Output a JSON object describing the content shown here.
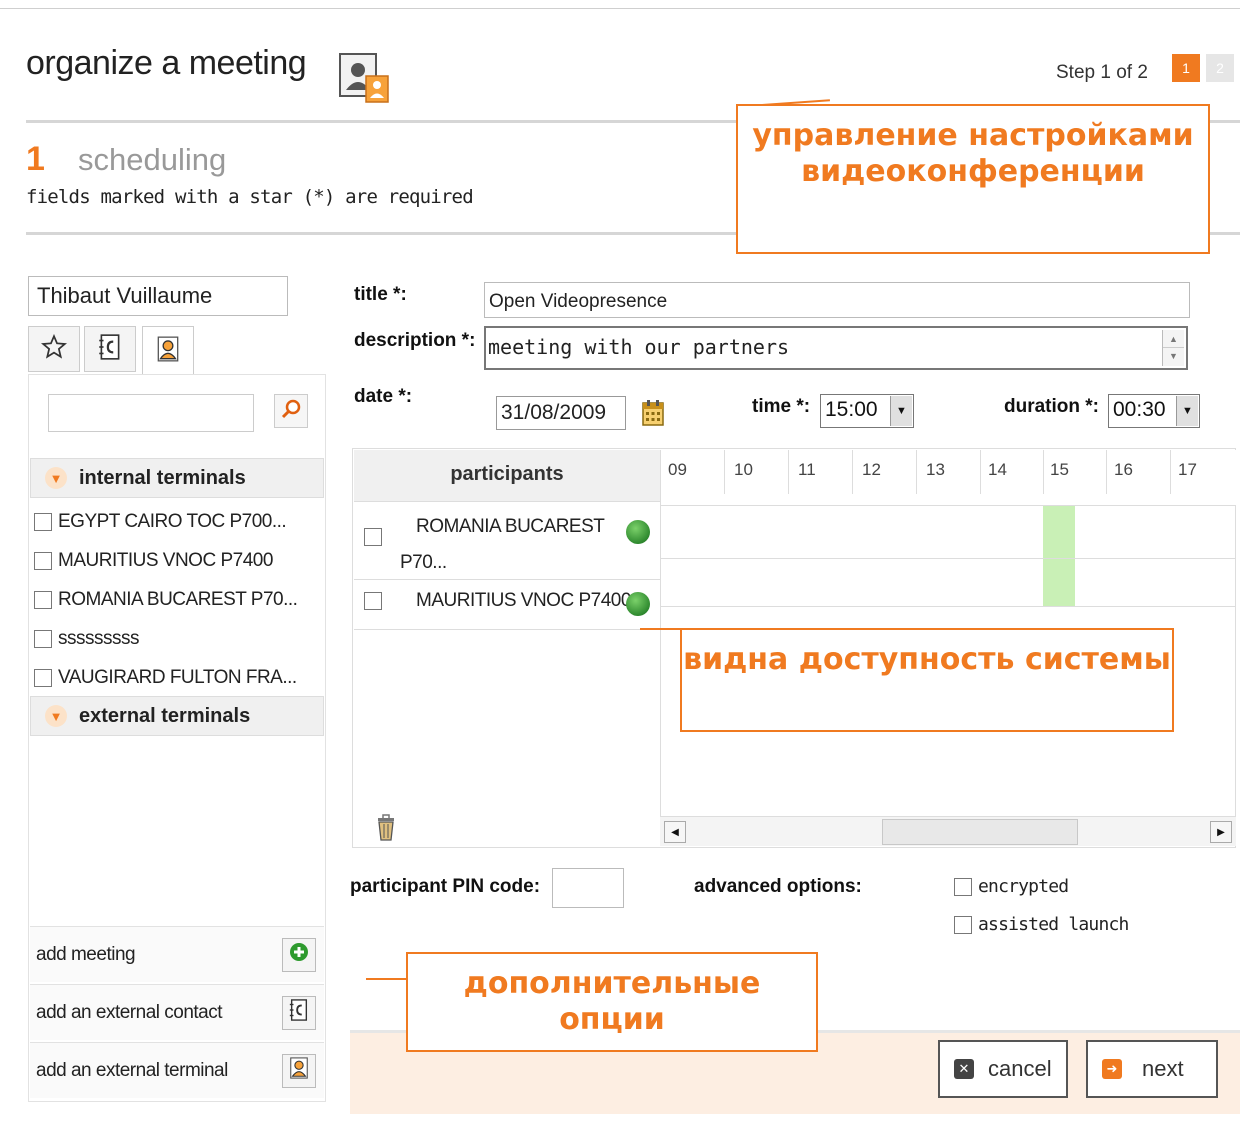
{
  "header": {
    "title": "organize a meeting",
    "step_text": "Step 1 of 2",
    "steps": [
      "1",
      "2"
    ],
    "icon": "contact-card-icon"
  },
  "section": {
    "number": "1",
    "name": "scheduling",
    "required_hint": "fields marked with a star (*) are required"
  },
  "annotations": {
    "settings": "управление настройками видеоконференции",
    "availability": "видна доступность системы",
    "options": "дополнительные опции"
  },
  "sidebar": {
    "user_name": "Thibaut Vuillaume",
    "tabs": [
      {
        "icon": "star-icon"
      },
      {
        "icon": "address-book-icon"
      },
      {
        "icon": "user-terminal-icon"
      }
    ],
    "search": {
      "value": "",
      "icon": "search-icon"
    },
    "groups": {
      "internal": "internal terminals",
      "external": "external terminals"
    },
    "internal_terminals": [
      "EGYPT CAIRO TOC P700...",
      "MAURITIUS VNOC P7400",
      "ROMANIA BUCAREST P70...",
      "sssssssss",
      "VAUGIRARD FULTON FRA..."
    ],
    "actions": [
      {
        "label": "add meeting",
        "icon": "plus-icon"
      },
      {
        "label": "add an external contact",
        "icon": "address-book-icon"
      },
      {
        "label": "add an external terminal",
        "icon": "user-terminal-icon"
      }
    ]
  },
  "form": {
    "title_label": "title *:",
    "title_value": "Open Videopresence",
    "description_label": "description *:",
    "description_value": "meeting with our partners",
    "date_label": "date *:",
    "date_value": "31/08/2009",
    "time_label": "time *:",
    "time_value": "15:00",
    "duration_label": "duration *:",
    "duration_value": "00:30",
    "pin_label": "participant PIN code:",
    "pin_value": "",
    "advanced_label": "advanced options:",
    "options": [
      "encrypted",
      "assisted launch"
    ]
  },
  "schedule": {
    "participants_header": "participants",
    "hours": [
      "09",
      "10",
      "11",
      "12",
      "13",
      "14",
      "15",
      "16",
      "17"
    ],
    "selected_hour": "15",
    "participants": [
      {
        "name_line1": "ROMANIA BUCAREST",
        "name_line2": "P70...",
        "status": "available"
      },
      {
        "name_line1": "MAURITIUS VNOC P7400",
        "name_line2": "",
        "status": "available"
      }
    ]
  },
  "buttons": {
    "cancel": "cancel",
    "next": "next"
  },
  "colors": {
    "accent": "#f07a20",
    "highlight": "#c9f0b6",
    "footer_bg": "#fdeee2"
  }
}
